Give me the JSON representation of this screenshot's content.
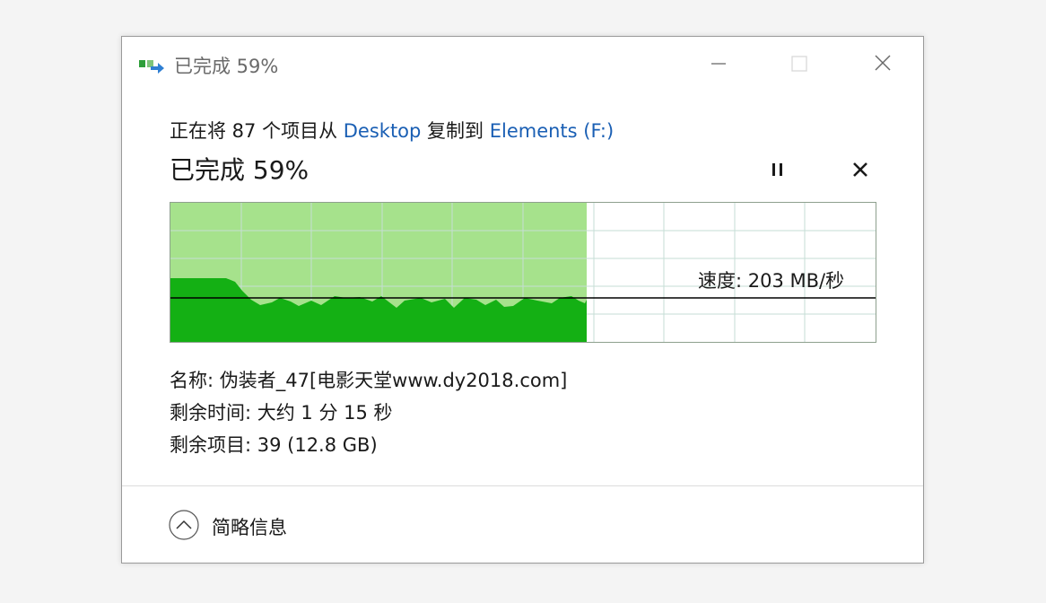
{
  "window": {
    "title": "已完成 59%",
    "controls": {
      "minimize_icon": "minimize-icon",
      "maximize_icon": "maximize-icon",
      "close_icon": "close-icon"
    }
  },
  "copy": {
    "prefix": "正在将 87 个项目从 ",
    "source": "Desktop",
    "middle": " 复制到 ",
    "destination": "Elements (F:)",
    "progress_heading": "已完成 59%",
    "progress_fraction": 0.59,
    "pause_icon": "pause-icon",
    "cancel_icon": "cancel-icon"
  },
  "graph": {
    "speed_label": "速度: 203 MB/秒",
    "colors": {
      "fill_light": "#a6e28c",
      "fill_dark": "#14b014",
      "grid": "#c5ddd5",
      "speed_line": "#000000",
      "border": "#8ea08e"
    }
  },
  "info": {
    "name": "名称: 伪装者_47[电影天堂www.dy2018.com]",
    "time_remaining": "剩余时间: 大约 1 分 15 秒",
    "items_remaining": "剩余项目: 39 (12.8 GB)"
  },
  "footer": {
    "toggle_label": "简略信息",
    "toggle_icon": "chevron-up-icon"
  },
  "accent": "#1a5fb4"
}
